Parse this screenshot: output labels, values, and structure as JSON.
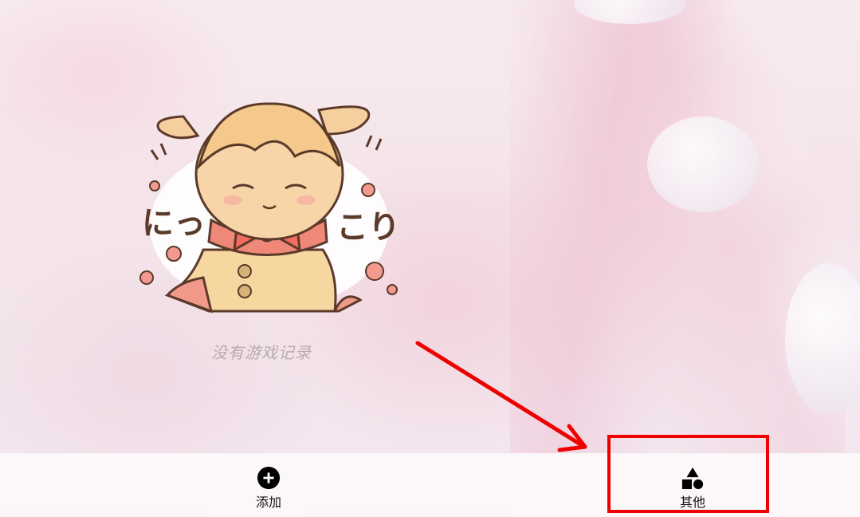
{
  "empty_state": {
    "message": "没有游戏记录",
    "mascot_text_left": "にっ",
    "mascot_text_right": "こり"
  },
  "bottom_nav": {
    "items": [
      {
        "label": "添加",
        "icon": "plus-circle-icon"
      },
      {
        "label": "其他",
        "icon": "shapes-icon"
      }
    ]
  },
  "colors": {
    "annotation": "#ee0000",
    "nav_bg": "#fcf7f9",
    "empty_text": "#b9aab1"
  }
}
